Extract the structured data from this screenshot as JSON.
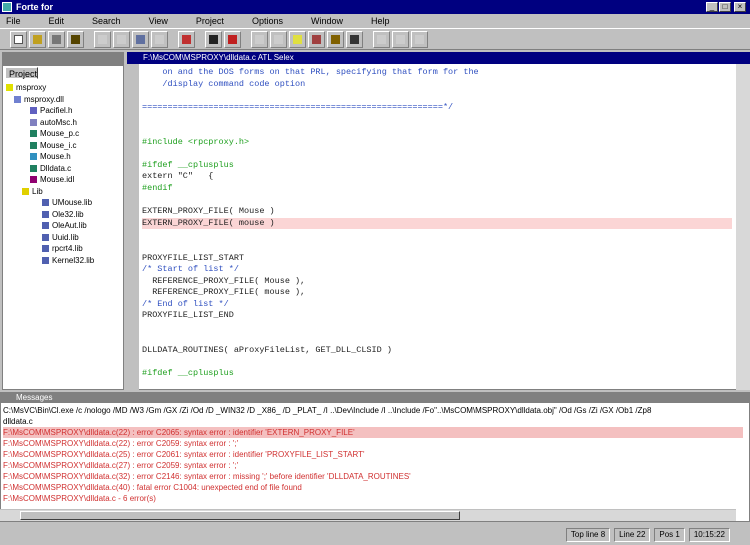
{
  "window": {
    "title": "Forte for"
  },
  "menu": [
    "File",
    "Edit",
    "Search",
    "View",
    "Project",
    "Options",
    "Window",
    "Help"
  ],
  "left_panel": {
    "tab": "Project",
    "root": "msproxy",
    "project": "msproxy.dll",
    "files": [
      {
        "name": "Pacifiel.h",
        "color": "#6060c0"
      },
      {
        "name": "autoMsc.h",
        "color": "#8080c0"
      },
      {
        "name": "Mouse_p.c",
        "color": "#208060"
      },
      {
        "name": "Mouse_i.c",
        "color": "#208060"
      },
      {
        "name": "Mouse.h",
        "color": "#3090c0"
      },
      {
        "name": "Dlldata.c",
        "color": "#208060"
      },
      {
        "name": "Mouse.idl",
        "color": "#900070"
      }
    ],
    "folder": "Lib",
    "libs": [
      "UMouse.lib",
      "Ole32.lib",
      "OleAut.lib",
      "Uuid.lib",
      "rpcrt4.lib",
      "Kernel32.lib"
    ]
  },
  "editor": {
    "title": "F:\\MsCOM\\MSPROXY\\dlldata.c    ATL Selex",
    "lines": [
      {
        "t": "    on and the DOS forms on that PRL, specifying that form for the",
        "c": "cmt"
      },
      {
        "t": "    /display command code option",
        "c": "cmt"
      },
      {
        "t": "",
        "c": "n"
      },
      {
        "t": "===========================================================*/",
        "c": "cmt"
      },
      {
        "t": "",
        "c": "n"
      },
      {
        "t": "",
        "c": "n"
      },
      {
        "t": "#include <rpcproxy.h>",
        "c": "pp"
      },
      {
        "t": "",
        "c": "n"
      },
      {
        "t": "#ifdef __cplusplus",
        "c": "pp"
      },
      {
        "t": "extern \"C\"   {",
        "c": "n"
      },
      {
        "t": "#endif",
        "c": "pp"
      },
      {
        "t": "",
        "c": "n"
      },
      {
        "t": "EXTERN_PROXY_FILE( Mouse )",
        "c": "n"
      },
      {
        "t": "EXTERN_PROXY_FILE( mouse )",
        "c": "n",
        "hl": true
      },
      {
        "t": "",
        "c": "n"
      },
      {
        "t": "",
        "c": "n"
      },
      {
        "t": "PROXYFILE_LIST_START",
        "c": "n"
      },
      {
        "t": "/* Start of list */",
        "c": "cmt"
      },
      {
        "t": "  REFERENCE_PROXY_FILE( Mouse ),",
        "c": "n"
      },
      {
        "t": "  REFERENCE_PROXY_FILE( mouse ),",
        "c": "n"
      },
      {
        "t": "/* End of list */",
        "c": "cmt"
      },
      {
        "t": "PROXYFILE_LIST_END",
        "c": "n"
      },
      {
        "t": "",
        "c": "n"
      },
      {
        "t": "",
        "c": "n"
      },
      {
        "t": "DLLDATA_ROUTINES( aProxyFileList, GET_DLL_CLSID )",
        "c": "n"
      },
      {
        "t": "",
        "c": "n"
      },
      {
        "t": "#ifdef __cplusplus",
        "c": "pp"
      }
    ]
  },
  "messages": {
    "title": "Messages",
    "lines": [
      {
        "t": "C:\\MsVC\\Bin\\Cl.exe /c /nologo /MD /W3 /Gm /GX /Zi /Od /D _WIN32 /D _X86_ /D _PLAT_ /I ..\\Dev\\Include /I ..\\Include /Fo\"..\\MsCOM\\MSPROXY\\dlldata.obj\" /Od /Gs /Zi /GX /Ob1 /Zp8",
        "c": "n"
      },
      {
        "t": "dlldata.c",
        "c": "n"
      },
      {
        "t": "F:\\MsCOM\\MSPROXY\\dlldata.c(22) : error C2065: syntax error : identifier 'EXTERN_PROXY_FILE'",
        "c": "err",
        "hl": true
      },
      {
        "t": "F:\\MsCOM\\MSPROXY\\dlldata.c(22) : error C2059: syntax error : ';'",
        "c": "err"
      },
      {
        "t": "F:\\MsCOM\\MSPROXY\\dlldata.c(25) : error C2061: syntax error : identifier 'PROXYFILE_LIST_START'",
        "c": "err"
      },
      {
        "t": "F:\\MsCOM\\MSPROXY\\dlldata.c(27) : error C2059: syntax error : ';'",
        "c": "err"
      },
      {
        "t": "F:\\MsCOM\\MSPROXY\\dlldata.c(32) : error C2146: syntax error : missing ';' before identifier 'DLLDATA_ROUTINES'",
        "c": "err"
      },
      {
        "t": "F:\\MsCOM\\MSPROXY\\dlldata.c(40) : fatal error C1004: unexpected end of file found",
        "c": "err"
      },
      {
        "t": "F:\\MsCOM\\MSPROXY\\dlldata.c - 6 error(s)",
        "c": "err"
      }
    ]
  },
  "status": {
    "mode": "Top line 8",
    "line": "Line 22",
    "col": "Pos 1",
    "time": "10:15:22"
  }
}
